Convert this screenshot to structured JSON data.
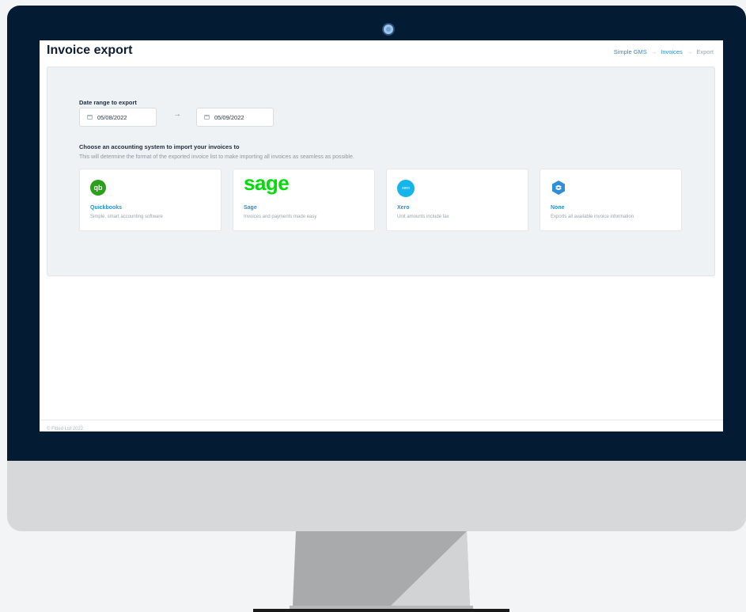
{
  "page": {
    "title": "Invoice export"
  },
  "breadcrumb": {
    "items": [
      "Simple GMS",
      "Invoices",
      "Export"
    ],
    "separator": "→"
  },
  "date_range": {
    "label": "Date range to export",
    "start": "05/08/2022",
    "end": "05/09/2022",
    "arrow": "→"
  },
  "accounting": {
    "label": "Choose an accounting system to import your invoices to",
    "helper": "This will determine the format of the exported invoice list to make importing all invoices as seamless as possible.",
    "options": [
      {
        "name": "Quickbooks",
        "description": "Simple, smart accounting software",
        "logo_text": "qb",
        "icon": "quickbooks-logo",
        "color": "#2ca01c"
      },
      {
        "name": "Sage",
        "description": "Invoices and payments made easy",
        "logo_text": "sage",
        "icon": "sage-logo",
        "color": "#00dc06"
      },
      {
        "name": "Xero",
        "description": "Unit amounts include tax",
        "logo_text": "xero",
        "icon": "xero-logo",
        "color": "#13b5ea"
      },
      {
        "name": "None",
        "description": "Exports all available invoice information",
        "logo_text": "",
        "icon": "none-logo",
        "color": "#2d8fd6"
      }
    ]
  },
  "footer": {
    "text": "© Fitted Ltd 2022"
  },
  "colors": {
    "bezel": "#041c33",
    "accent": "#2d8fd6",
    "panel": "#eef2f5"
  }
}
